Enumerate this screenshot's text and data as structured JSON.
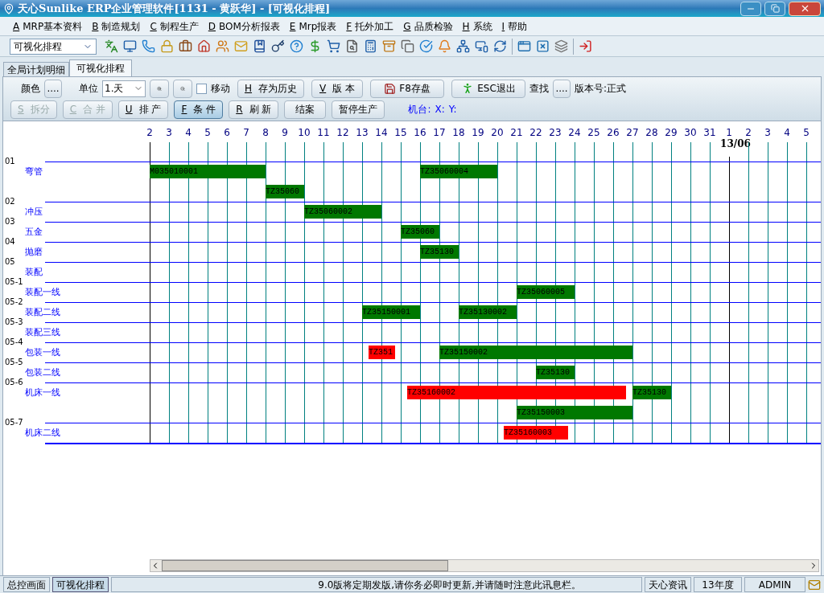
{
  "window": {
    "title": "天心Sunlike ERP企业管理软件[1131 - 黄跃华] - [可视化排程]"
  },
  "menu": [
    {
      "key": "A",
      "label": "MRP基本资料"
    },
    {
      "key": "B",
      "label": "制造规划"
    },
    {
      "key": "C",
      "label": "制程生产"
    },
    {
      "key": "D",
      "label": "BOM分析报表"
    },
    {
      "key": "E",
      "label": "Mrp报表"
    },
    {
      "key": "F",
      "label": "托外加工"
    },
    {
      "key": "G",
      "label": "品质检验"
    },
    {
      "key": "H",
      "label": "系统"
    },
    {
      "key": "I",
      "label": "帮助"
    }
  ],
  "module_select": {
    "value": "可视化排程"
  },
  "tabs": [
    {
      "label": "全局计划明细",
      "selected": false
    },
    {
      "label": "可视化排程",
      "selected": true
    }
  ],
  "controls": {
    "color_label": "颜色",
    "color_button": "....",
    "unit_label": "单位",
    "unit_value": "1.天",
    "move": {
      "label": "移动",
      "checked": false
    },
    "row1_buttons": [
      {
        "key": "H",
        "label": "存为历史",
        "kind": "text"
      },
      {
        "key": "V",
        "label": "版 本",
        "kind": "text"
      },
      {
        "label": "F8存盘",
        "kind": "save"
      },
      {
        "label": "ESC退出",
        "kind": "exit"
      }
    ],
    "find_label": "查找",
    "find_button": "....",
    "version": "版本号:正式",
    "row2_buttons": [
      {
        "key": "S",
        "label": "拆分",
        "disabled": true,
        "selected": false
      },
      {
        "key": "C",
        "label": "合 并",
        "disabled": true,
        "selected": false
      },
      {
        "key": "U",
        "label": "排 产",
        "disabled": false,
        "selected": false
      },
      {
        "key": "F",
        "label": "条 件",
        "disabled": false,
        "selected": true
      },
      {
        "key": "R",
        "label": "刷 新",
        "disabled": false,
        "selected": false
      },
      {
        "label": "结案",
        "disabled": false,
        "selected": false
      },
      {
        "label": "暂停生产",
        "disabled": false,
        "selected": false
      }
    ],
    "machine_label": "机台:",
    "x_label": "X:",
    "y_label": "Y:"
  },
  "gantt": {
    "days": [
      {
        "label": "2"
      },
      {
        "label": "3"
      },
      {
        "label": "4"
      },
      {
        "label": "5"
      },
      {
        "label": "6"
      },
      {
        "label": "7"
      },
      {
        "label": "8"
      },
      {
        "label": "9"
      },
      {
        "label": "10"
      },
      {
        "label": "11"
      },
      {
        "label": "12"
      },
      {
        "label": "13"
      },
      {
        "label": "14"
      },
      {
        "label": "15"
      },
      {
        "label": "16"
      },
      {
        "label": "17"
      },
      {
        "label": "18"
      },
      {
        "label": "19"
      },
      {
        "label": "20"
      },
      {
        "label": "21"
      },
      {
        "label": "22"
      },
      {
        "label": "23"
      },
      {
        "label": "24"
      },
      {
        "label": "25"
      },
      {
        "label": "26"
      },
      {
        "label": "27"
      },
      {
        "label": "28"
      },
      {
        "label": "29"
      },
      {
        "label": "30"
      },
      {
        "label": "31"
      },
      {
        "label": "1",
        "month": "13/06"
      },
      {
        "label": "2"
      },
      {
        "label": "3"
      },
      {
        "label": "4"
      },
      {
        "label": "5"
      }
    ],
    "rows": [
      {
        "code": "01",
        "name": "弯管",
        "bars": [
          {
            "label": "M035010001",
            "color": "#007800"
          },
          {
            "label": "TZ35060004",
            "color": "#007800"
          },
          {
            "label": "TZ35060",
            "color": "#007800"
          }
        ]
      },
      {
        "code": "02",
        "name": "冲压",
        "bars": [
          {
            "label": "TZ35060002",
            "color": "#007800"
          }
        ]
      },
      {
        "code": "03",
        "name": "五金",
        "bars": [
          {
            "label": "TZ35060",
            "color": "#007800"
          }
        ]
      },
      {
        "code": "04",
        "name": "抛磨",
        "bars": [
          {
            "label": "TZ35130",
            "color": "#007800"
          }
        ]
      },
      {
        "code": "05",
        "name": "装配",
        "bars": []
      },
      {
        "code": "05-1",
        "name": "装配一线",
        "bars": [
          {
            "label": "TZ35060005",
            "color": "#007800"
          }
        ]
      },
      {
        "code": "05-2",
        "name": "装配二线",
        "bars": [
          {
            "label": "TZ35150001",
            "color": "#007800"
          },
          {
            "label": "TZ35130002",
            "color": "#007800"
          }
        ]
      },
      {
        "code": "05-3",
        "name": "装配三线",
        "bars": []
      },
      {
        "code": "05-4",
        "name": "包装一线",
        "bars": [
          {
            "label": "TZ351",
            "color": "#ff0000"
          },
          {
            "label": "TZ35150002",
            "color": "#007800"
          }
        ]
      },
      {
        "code": "05-5",
        "name": "包装二线",
        "bars": [
          {
            "label": "TZ35130",
            "color": "#007800"
          }
        ]
      },
      {
        "code": "05-6",
        "name": "机床一线",
        "bars": [
          {
            "label": "TZ35160002",
            "color": "#ff0000"
          },
          {
            "label": "TZ35130",
            "color": "#007800"
          },
          {
            "label": "TZ35150003",
            "color": "#007800"
          }
        ]
      },
      {
        "code": "05-7",
        "name": "机床二线",
        "bars": [
          {
            "label": "TZ35160003",
            "color": "#ff0000"
          }
        ]
      }
    ]
  },
  "status_bar": {
    "tabs": [
      {
        "label": "总控画面",
        "selected": false
      },
      {
        "label": "可视化排程",
        "selected": true
      }
    ],
    "message": "9.0版将定期发版,请你务必即时更新,并请随时注意此讯息栏。",
    "news": "天心资讯",
    "year": "13年度",
    "user": "ADMIN"
  }
}
